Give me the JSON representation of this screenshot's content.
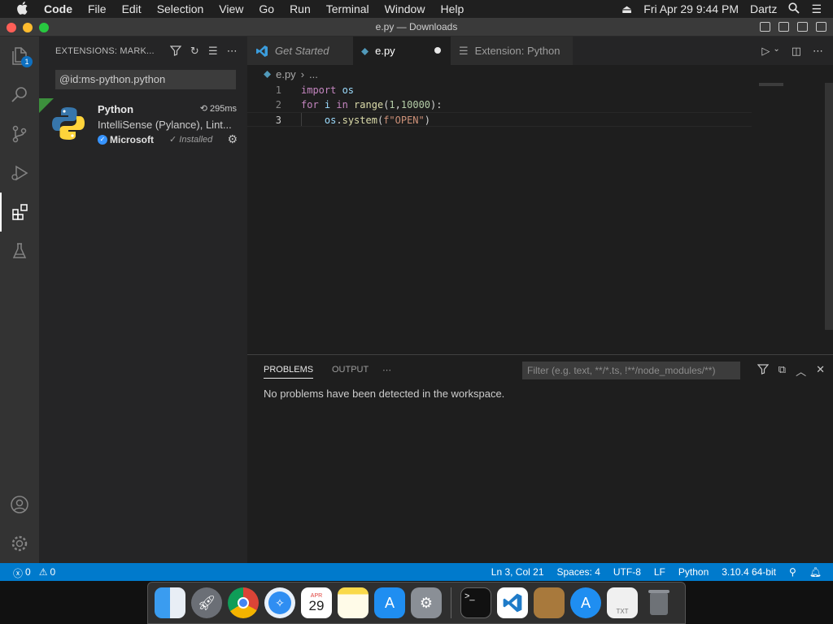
{
  "menubar": {
    "app": "Code",
    "items": [
      "File",
      "Edit",
      "Selection",
      "View",
      "Go",
      "Run",
      "Terminal",
      "Window",
      "Help"
    ],
    "datetime": "Fri Apr 29  9:44 PM",
    "user": "Dartz"
  },
  "window": {
    "title": "e.py — Downloads"
  },
  "activity": {
    "explorer_badge": "1"
  },
  "sidebar": {
    "header": "EXTENSIONS: MARK...",
    "search_value": "@id:ms-python.python",
    "extension": {
      "name": "Python",
      "time": "295ms",
      "description": "IntelliSense (Pylance), Lint...",
      "publisher": "Microsoft",
      "status": "Installed"
    }
  },
  "tabs": [
    {
      "label": "Get Started"
    },
    {
      "label": "e.py"
    },
    {
      "label": "Extension: Python"
    }
  ],
  "breadcrumb": {
    "file": "e.py",
    "rest": "..."
  },
  "code": {
    "line_numbers": [
      "1",
      "2",
      "3"
    ],
    "line1": {
      "kw": "import",
      "mod": " os"
    },
    "line2": {
      "kw1": "for",
      "var": " i ",
      "kw2": "in",
      "fn": " range",
      "open": "(",
      "n1": "1",
      "comma": ",",
      "n2": "10000",
      "close": "):"
    },
    "line3": {
      "indent": "    ",
      "obj": "os",
      "dot": ".",
      "fn": "system",
      "open": "(",
      "str": "f\"OPEN\"",
      "close": ")"
    }
  },
  "panel": {
    "tabs": [
      "PROBLEMS",
      "OUTPUT"
    ],
    "filter_placeholder": "Filter (e.g. text, **/*.ts, !**/node_modules/**)",
    "message": "No problems have been detected in the workspace."
  },
  "statusbar": {
    "errors": "0",
    "warnings": "0",
    "position": "Ln 3, Col 21",
    "spaces": "Spaces: 4",
    "encoding": "UTF-8",
    "eol": "LF",
    "language": "Python",
    "interpreter": "3.10.4 64-bit"
  },
  "dock": {
    "calendar_month": "APR",
    "calendar_day": "29",
    "items": [
      "finder",
      "launchpad",
      "chrome",
      "safari",
      "calendar",
      "notes",
      "app-store",
      "system-preferences",
      "terminal",
      "vscode",
      "archive",
      "app-store-2",
      "text-file",
      "trash"
    ]
  },
  "colors": {
    "accent": "#007acc",
    "activity_bg": "#333333",
    "sidebar_bg": "#252526",
    "editor_bg": "#1e1e1e"
  }
}
